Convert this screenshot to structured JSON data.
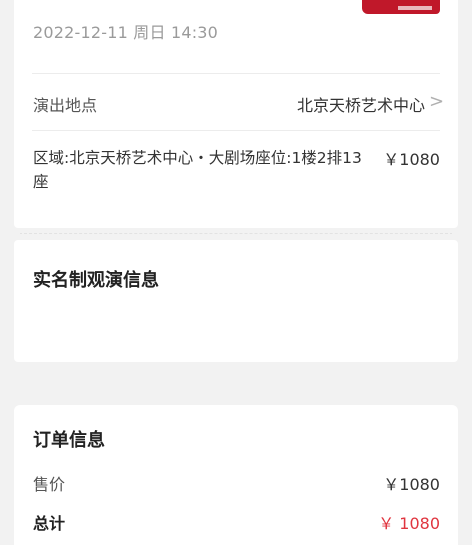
{
  "event": {
    "datetime": "2022-12-11 周日 14:30"
  },
  "venue": {
    "label": "演出地点",
    "value": "北京天桥艺术中心",
    "chevron": ">"
  },
  "seat": {
    "description": "区域:北京天桥艺术中心・大剧场座位:1楼2排13座",
    "price": "￥1080"
  },
  "realname": {
    "title": "实名制观演信息"
  },
  "order": {
    "title": "订单信息",
    "price_label": "售价",
    "price_value": "￥1080",
    "total_label": "总计",
    "total_value": "￥ 1080"
  },
  "colors": {
    "accent": "#e0353f",
    "poster": "#c0182a",
    "background": "#f2f2f2"
  },
  "icons": {
    "venue_arrow": "chevron-right-icon"
  }
}
